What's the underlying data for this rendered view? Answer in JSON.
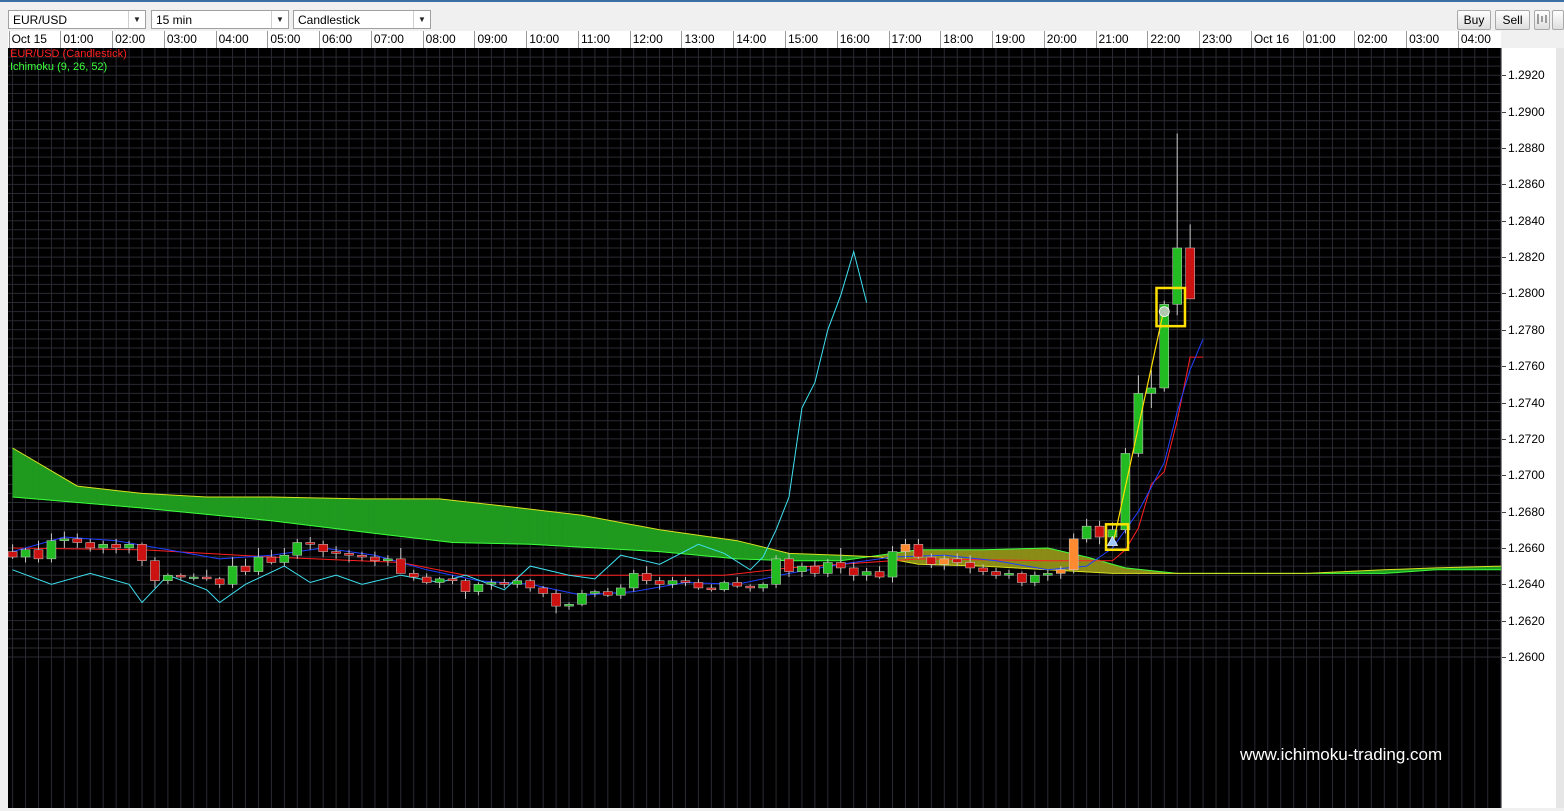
{
  "toolbar": {
    "symbol": "EUR/USD",
    "interval": "15 min",
    "chart_type": "Candlestick",
    "buy_label": "Buy",
    "sell_label": "Sell"
  },
  "legend": {
    "series": "EUR/USD (Candlestick)",
    "indicator": "Ichimoku (9, 26, 52)"
  },
  "watermark": "www.ichimoku-trading.com",
  "time_labels": [
    "Oct 15",
    "01:00",
    "02:00",
    "03:00",
    "04:00",
    "05:00",
    "06:00",
    "07:00",
    "08:00",
    "09:00",
    "10:00",
    "11:00",
    "12:00",
    "13:00",
    "14:00",
    "15:00",
    "16:00",
    "17:00",
    "18:00",
    "19:00",
    "20:00",
    "21:00",
    "22:00",
    "23:00",
    "Oct 16",
    "01:00",
    "02:00",
    "03:00",
    "04:00"
  ],
  "y_labels": [
    "1.2920",
    "1.2900",
    "1.2880",
    "1.2860",
    "1.2840",
    "1.2820",
    "1.2800",
    "1.2780",
    "1.2760",
    "1.2740",
    "1.2720",
    "1.2700",
    "1.2680",
    "1.2660",
    "1.2640",
    "1.2620",
    "1.2600"
  ],
  "colors": {
    "background": "#000000",
    "grid": "#2a2a33",
    "bull": "#22bb22",
    "bear": "#cc1111",
    "bull_in_cloud": "#ff8a30",
    "tenkan": "#2040ff",
    "kijun": "#ff2020",
    "chikou": "#40e0f0",
    "kumo_bear": "#8b8b18",
    "kumo_bull": "#1f9a1f",
    "span_a": "#d8e020",
    "span_b": "#3cff3c",
    "highlight": "#ffe000"
  },
  "chart_data": {
    "type": "candlestick",
    "title": "EUR/USD (Candlestick)",
    "indicator": "Ichimoku (9, 26, 52)",
    "interval": "15 min",
    "ylim": [
      1.2595,
      1.2935
    ],
    "grid": true,
    "legend_position": "top-left",
    "x_start": "Oct 15 00:00",
    "candles": [
      [
        1.2658,
        1.2662,
        1.2654,
        1.2655
      ],
      [
        1.2655,
        1.266,
        1.2652,
        1.2659
      ],
      [
        1.2659,
        1.2664,
        1.2652,
        1.2654
      ],
      [
        1.2654,
        1.2668,
        1.2652,
        1.2664
      ],
      [
        1.2664,
        1.2669,
        1.266,
        1.2665
      ],
      [
        1.2665,
        1.2668,
        1.266,
        1.2663
      ],
      [
        1.2663,
        1.2665,
        1.2658,
        1.266
      ],
      [
        1.266,
        1.2664,
        1.2657,
        1.2662
      ],
      [
        1.2662,
        1.2665,
        1.2657,
        1.266
      ],
      [
        1.266,
        1.2664,
        1.2657,
        1.2662
      ],
      [
        1.2662,
        1.2663,
        1.265,
        1.2653
      ],
      [
        1.2653,
        1.2655,
        1.2638,
        1.2642
      ],
      [
        1.2642,
        1.2646,
        1.264,
        1.2645
      ],
      [
        1.2645,
        1.2646,
        1.2642,
        1.2644
      ],
      [
        1.2644,
        1.2646,
        1.2642,
        1.2644
      ],
      [
        1.2644,
        1.2648,
        1.2642,
        1.2643
      ],
      [
        1.2643,
        1.2644,
        1.2638,
        1.264
      ],
      [
        1.264,
        1.2655,
        1.2638,
        1.265
      ],
      [
        1.265,
        1.2654,
        1.2645,
        1.2647
      ],
      [
        1.2647,
        1.266,
        1.2645,
        1.2655
      ],
      [
        1.2655,
        1.2659,
        1.2651,
        1.2652
      ],
      [
        1.2652,
        1.266,
        1.265,
        1.2656
      ],
      [
        1.2656,
        1.2665,
        1.2654,
        1.2663
      ],
      [
        1.2663,
        1.2666,
        1.2659,
        1.2662
      ],
      [
        1.2662,
        1.2664,
        1.2655,
        1.2658
      ],
      [
        1.2658,
        1.2661,
        1.2654,
        1.2657
      ],
      [
        1.2657,
        1.2659,
        1.2652,
        1.2656
      ],
      [
        1.2656,
        1.2658,
        1.2653,
        1.2655
      ],
      [
        1.2655,
        1.2658,
        1.265,
        1.2653
      ],
      [
        1.2653,
        1.2656,
        1.265,
        1.2654
      ],
      [
        1.2654,
        1.266,
        1.2648,
        1.2646
      ],
      [
        1.2646,
        1.2648,
        1.2642,
        1.2644
      ],
      [
        1.2644,
        1.2646,
        1.264,
        1.2641
      ],
      [
        1.2641,
        1.2644,
        1.2638,
        1.2643
      ],
      [
        1.2643,
        1.2645,
        1.264,
        1.2642
      ],
      [
        1.2642,
        1.2643,
        1.2632,
        1.2636
      ],
      [
        1.2636,
        1.2641,
        1.2634,
        1.264
      ],
      [
        1.264,
        1.2643,
        1.2637,
        1.2641
      ],
      [
        1.2641,
        1.2643,
        1.2638,
        1.264
      ],
      [
        1.264,
        1.2644,
        1.2638,
        1.2642
      ],
      [
        1.2642,
        1.2643,
        1.2636,
        1.2638
      ],
      [
        1.2638,
        1.2639,
        1.2633,
        1.2635
      ],
      [
        1.2635,
        1.2637,
        1.2624,
        1.2628
      ],
      [
        1.2628,
        1.263,
        1.2626,
        1.2629
      ],
      [
        1.2629,
        1.2637,
        1.2628,
        1.2635
      ],
      [
        1.2635,
        1.2637,
        1.2633,
        1.2636
      ],
      [
        1.2636,
        1.2638,
        1.2633,
        1.2634
      ],
      [
        1.2634,
        1.264,
        1.2632,
        1.2638
      ],
      [
        1.2638,
        1.2648,
        1.2636,
        1.2646
      ],
      [
        1.2646,
        1.265,
        1.264,
        1.2642
      ],
      [
        1.2642,
        1.2644,
        1.2637,
        1.264
      ],
      [
        1.264,
        1.2644,
        1.2638,
        1.2642
      ],
      [
        1.2642,
        1.2644,
        1.2639,
        1.2641
      ],
      [
        1.2641,
        1.2643,
        1.2637,
        1.2638
      ],
      [
        1.2638,
        1.264,
        1.2636,
        1.2637
      ],
      [
        1.2637,
        1.2642,
        1.2636,
        1.2641
      ],
      [
        1.2641,
        1.2644,
        1.2638,
        1.2639
      ],
      [
        1.2639,
        1.264,
        1.2636,
        1.2638
      ],
      [
        1.2638,
        1.2641,
        1.2636,
        1.264
      ],
      [
        1.264,
        1.2656,
        1.2638,
        1.2654
      ],
      [
        1.2654,
        1.2657,
        1.2644,
        1.2647
      ],
      [
        1.2647,
        1.2652,
        1.2644,
        1.265
      ],
      [
        1.265,
        1.2653,
        1.2644,
        1.2646
      ],
      [
        1.2646,
        1.2654,
        1.2644,
        1.2652
      ],
      [
        1.2652,
        1.266,
        1.2646,
        1.2649
      ],
      [
        1.2649,
        1.2652,
        1.2642,
        1.2645
      ],
      [
        1.2645,
        1.2649,
        1.2642,
        1.2647
      ],
      [
        1.2647,
        1.265,
        1.2643,
        1.2644
      ],
      [
        1.2644,
        1.2661,
        1.2641,
        1.2658
      ],
      [
        1.2658,
        1.2665,
        1.2654,
        1.2662
      ],
      [
        1.2662,
        1.2665,
        1.2654,
        1.2655
      ],
      [
        1.2655,
        1.2657,
        1.2649,
        1.2651
      ],
      [
        1.2651,
        1.2656,
        1.2648,
        1.2654
      ],
      [
        1.2654,
        1.2657,
        1.265,
        1.2652
      ],
      [
        1.2652,
        1.2656,
        1.2646,
        1.2649
      ],
      [
        1.2649,
        1.2651,
        1.2645,
        1.2647
      ],
      [
        1.2647,
        1.2649,
        1.2643,
        1.2645
      ],
      [
        1.2645,
        1.2648,
        1.2643,
        1.2646
      ],
      [
        1.2646,
        1.2647,
        1.2639,
        1.2641
      ],
      [
        1.2641,
        1.2647,
        1.2639,
        1.2645
      ],
      [
        1.2645,
        1.2648,
        1.2642,
        1.2646
      ],
      [
        1.2646,
        1.265,
        1.2643,
        1.2648
      ],
      [
        1.2648,
        1.2668,
        1.2646,
        1.2665
      ],
      [
        1.2665,
        1.2676,
        1.2663,
        1.2672
      ],
      [
        1.2672,
        1.2675,
        1.2662,
        1.2666
      ],
      [
        1.2666,
        1.2674,
        1.2664,
        1.267
      ],
      [
        1.267,
        1.2715,
        1.2668,
        1.2712
      ],
      [
        1.2712,
        1.2755,
        1.271,
        1.2745
      ],
      [
        1.2745,
        1.2758,
        1.2737,
        1.2748
      ],
      [
        1.2748,
        1.2796,
        1.2746,
        1.2794
      ],
      [
        1.2794,
        1.2888,
        1.2788,
        1.2825
      ],
      [
        1.2825,
        1.2838,
        1.2797,
        1.2797
      ]
    ],
    "tenkan_sen": [
      [
        0,
        1.2658
      ],
      [
        4,
        1.2666
      ],
      [
        8,
        1.2664
      ],
      [
        12,
        1.2659
      ],
      [
        16,
        1.2654
      ],
      [
        20,
        1.2656
      ],
      [
        24,
        1.266
      ],
      [
        28,
        1.2656
      ],
      [
        32,
        1.2648
      ],
      [
        36,
        1.2642
      ],
      [
        40,
        1.264
      ],
      [
        44,
        1.2634
      ],
      [
        48,
        1.2636
      ],
      [
        52,
        1.2641
      ],
      [
        56,
        1.264
      ],
      [
        60,
        1.2646
      ],
      [
        64,
        1.2651
      ],
      [
        68,
        1.2655
      ],
      [
        72,
        1.2656
      ],
      [
        76,
        1.2653
      ],
      [
        80,
        1.2648
      ],
      [
        83,
        1.265
      ],
      [
        85,
        1.266
      ],
      [
        87,
        1.268
      ],
      [
        89,
        1.2707
      ],
      [
        90,
        1.2735
      ],
      [
        91,
        1.2758
      ],
      [
        92,
        1.2775
      ]
    ],
    "kijun_sen": [
      [
        0,
        1.266
      ],
      [
        10,
        1.2659
      ],
      [
        20,
        1.2655
      ],
      [
        30,
        1.2652
      ],
      [
        35,
        1.2645
      ],
      [
        40,
        1.2645
      ],
      [
        55,
        1.2645
      ],
      [
        60,
        1.2649
      ],
      [
        70,
        1.2654
      ],
      [
        80,
        1.2653
      ],
      [
        85,
        1.2653
      ],
      [
        86,
        1.2659
      ],
      [
        87,
        1.2671
      ],
      [
        88,
        1.2695
      ],
      [
        89,
        1.2702
      ],
      [
        90,
        1.273
      ],
      [
        91,
        1.2765
      ],
      [
        92,
        1.2765
      ]
    ],
    "chikou_span": [
      [
        0,
        1.2648
      ],
      [
        3,
        1.264
      ],
      [
        6,
        1.2646
      ],
      [
        9,
        1.264
      ],
      [
        10,
        1.263
      ],
      [
        12,
        1.2645
      ],
      [
        15,
        1.2637
      ],
      [
        16,
        1.263
      ],
      [
        18,
        1.264
      ],
      [
        21,
        1.265
      ],
      [
        23,
        1.2641
      ],
      [
        25,
        1.2645
      ],
      [
        27,
        1.264
      ],
      [
        30,
        1.2645
      ],
      [
        33,
        1.2641
      ],
      [
        35,
        1.2645
      ],
      [
        38,
        1.2637
      ],
      [
        40,
        1.265
      ],
      [
        43,
        1.2645
      ],
      [
        45,
        1.2643
      ],
      [
        47,
        1.2656
      ],
      [
        50,
        1.2651
      ],
      [
        53,
        1.2662
      ],
      [
        55,
        1.2657
      ],
      [
        57,
        1.2648
      ],
      [
        58,
        1.2655
      ],
      [
        59,
        1.267
      ],
      [
        60,
        1.2688
      ],
      [
        61,
        1.2737
      ],
      [
        62,
        1.2751
      ],
      [
        63,
        1.278
      ],
      [
        64,
        1.2799
      ],
      [
        65,
        1.2823
      ],
      [
        66,
        1.2795
      ]
    ],
    "senkou_span_a": [
      [
        0,
        1.2715
      ],
      [
        5,
        1.2694
      ],
      [
        10,
        1.269
      ],
      [
        15,
        1.2688
      ],
      [
        20,
        1.2688
      ],
      [
        27,
        1.2687
      ],
      [
        33,
        1.2687
      ],
      [
        38,
        1.2683
      ],
      [
        44,
        1.2678
      ],
      [
        50,
        1.267
      ],
      [
        56,
        1.2664
      ],
      [
        60,
        1.2657
      ],
      [
        64,
        1.2656
      ],
      [
        67,
        1.2655
      ],
      [
        70,
        1.2651
      ],
      [
        75,
        1.265
      ],
      [
        80,
        1.2648
      ],
      [
        85,
        1.2646
      ],
      [
        90,
        1.2646
      ],
      [
        96,
        1.2646
      ],
      [
        100,
        1.2646
      ],
      [
        106,
        1.2648
      ],
      [
        110,
        1.2649
      ],
      [
        115,
        1.265
      ],
      [
        118,
        1.2654
      ],
      [
        121,
        1.2653
      ],
      [
        127,
        1.2651
      ],
      [
        132,
        1.265
      ],
      [
        135,
        1.2651
      ],
      [
        138,
        1.2664
      ],
      [
        141,
        1.267
      ],
      [
        142,
        1.2683
      ],
      [
        144,
        1.271
      ],
      [
        146,
        1.2717
      ],
      [
        149,
        1.2746
      ],
      [
        152,
        1.2765
      ]
    ],
    "senkou_span_b": [
      [
        0,
        1.2688
      ],
      [
        10,
        1.2682
      ],
      [
        20,
        1.2675
      ],
      [
        28,
        1.2668
      ],
      [
        34,
        1.2663
      ],
      [
        40,
        1.2662
      ],
      [
        50,
        1.2658
      ],
      [
        56,
        1.2654
      ],
      [
        60,
        1.2653
      ],
      [
        64,
        1.2653
      ],
      [
        67,
        1.2656
      ],
      [
        70,
        1.2659
      ],
      [
        75,
        1.2659
      ],
      [
        80,
        1.266
      ],
      [
        83,
        1.2655
      ],
      [
        86,
        1.2649
      ],
      [
        90,
        1.2646
      ],
      [
        96,
        1.2646
      ],
      [
        100,
        1.2646
      ],
      [
        106,
        1.2646
      ],
      [
        110,
        1.2648
      ],
      [
        115,
        1.2648
      ],
      [
        118,
        1.2648
      ],
      [
        121,
        1.265
      ],
      [
        127,
        1.265
      ],
      [
        132,
        1.2651
      ],
      [
        135,
        1.2655
      ],
      [
        138,
        1.2666
      ],
      [
        141,
        1.2674
      ],
      [
        142,
        1.2685
      ],
      [
        144,
        1.2712
      ],
      [
        146,
        1.2722
      ],
      [
        149,
        1.2752
      ],
      [
        152,
        1.2769
      ]
    ],
    "signal_line": [
      [
        85,
        1.2661
      ],
      [
        89,
        1.2792
      ]
    ],
    "markers": [
      {
        "type": "triangle",
        "index": 85,
        "price": 1.2663
      },
      {
        "type": "circle",
        "index": 89,
        "price": 1.279
      }
    ],
    "highlight_boxes": [
      {
        "from": 84.5,
        "to": 86.2,
        "low": 1.2659,
        "high": 1.2673
      },
      {
        "from": 88.4,
        "to": 90.6,
        "low": 1.2782,
        "high": 1.2803
      }
    ]
  }
}
